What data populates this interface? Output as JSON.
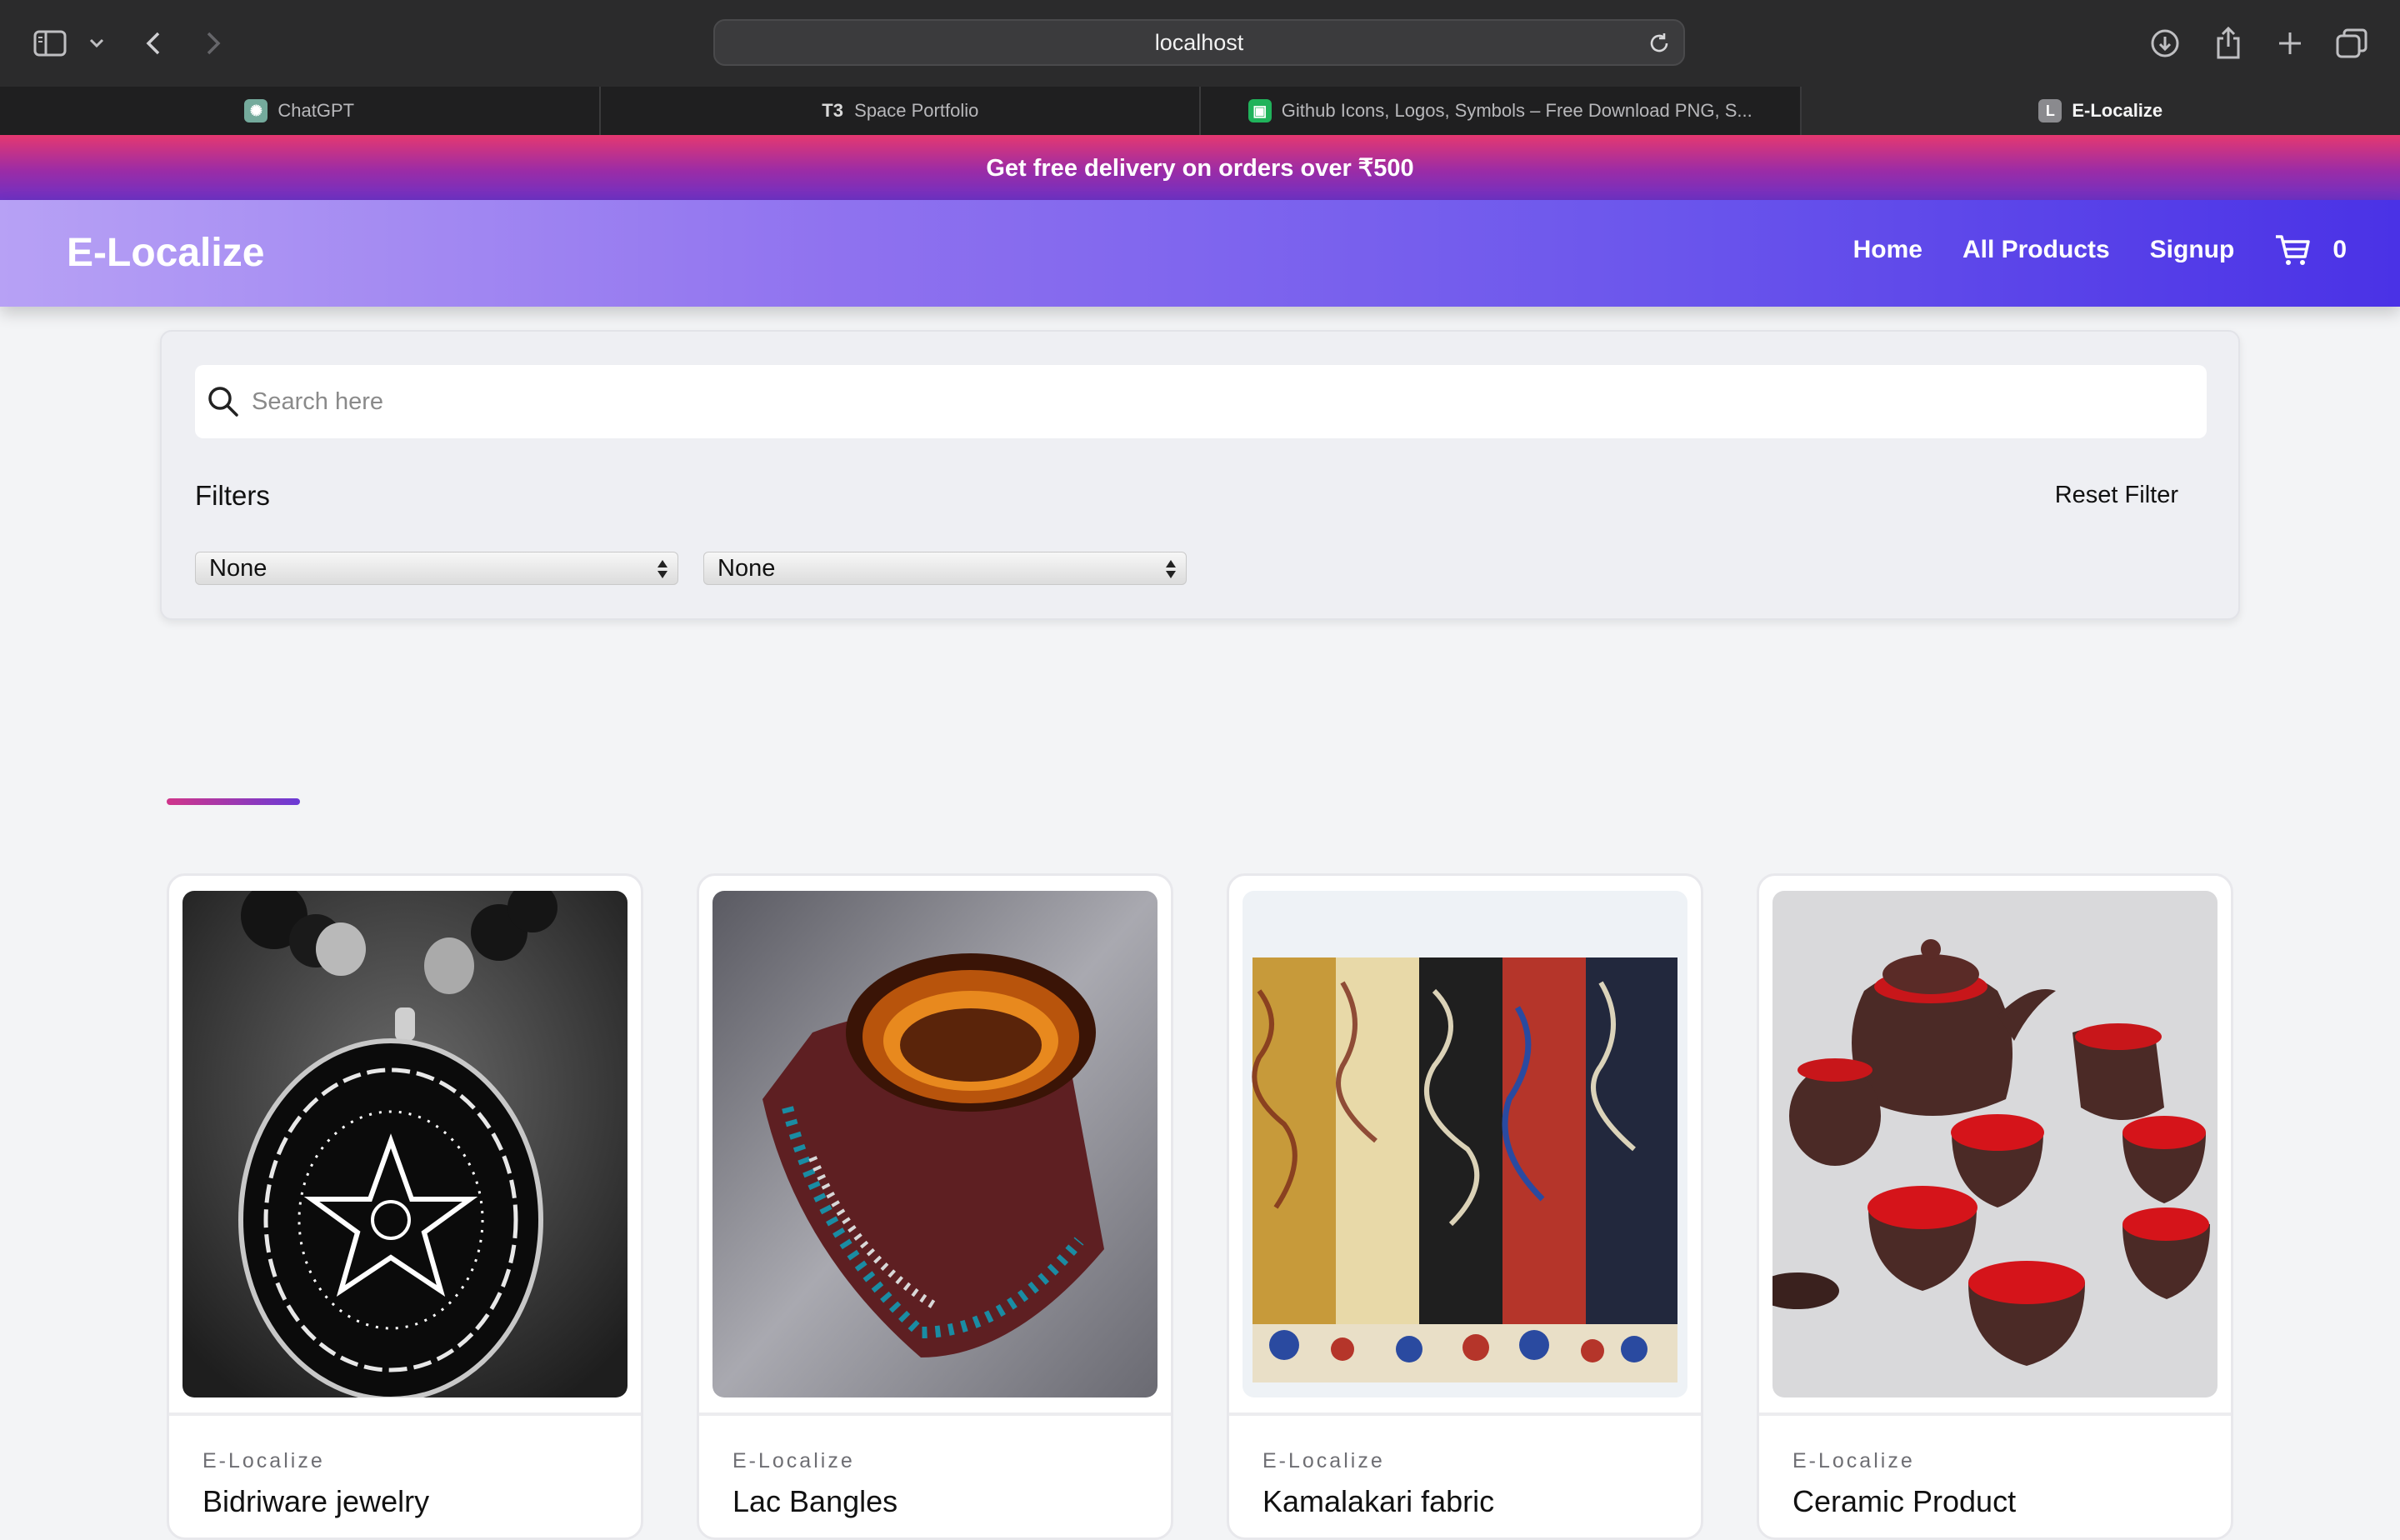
{
  "browser": {
    "url": "localhost",
    "tabs": [
      {
        "title": "ChatGPT",
        "icon": "chatgpt-icon"
      },
      {
        "title": "Space Portfolio",
        "icon": "t3-icon"
      },
      {
        "title": "Github Icons, Logos, Symbols – Free Download PNG, S...",
        "icon": "iconscout-icon"
      },
      {
        "title": "E-Localize",
        "icon": "l-icon",
        "active": true
      }
    ]
  },
  "promo": {
    "text": "Get free delivery on orders over ₹500"
  },
  "nav": {
    "brand": "E-Localize",
    "links": [
      "Home",
      "All Products",
      "Signup"
    ],
    "cart_count": "0"
  },
  "search": {
    "placeholder": "Search here",
    "value": ""
  },
  "filters": {
    "label": "Filters",
    "reset_label": "Reset Filter",
    "select_1": "None",
    "select_2": "None"
  },
  "products": [
    {
      "vendor": "E-Localize",
      "name": "Bidriware jewelry"
    },
    {
      "vendor": "E-Localize",
      "name": "Lac Bangles"
    },
    {
      "vendor": "E-Localize",
      "name": "Kamalakari fabric"
    },
    {
      "vendor": "E-Localize",
      "name": "Ceramic Product"
    }
  ],
  "colors": {
    "promo_gradient": [
      "#e53870",
      "#6d31c4"
    ],
    "nav_gradient": [
      "#b7a1f5",
      "#4a32e6"
    ],
    "accent": "#d0358a"
  }
}
